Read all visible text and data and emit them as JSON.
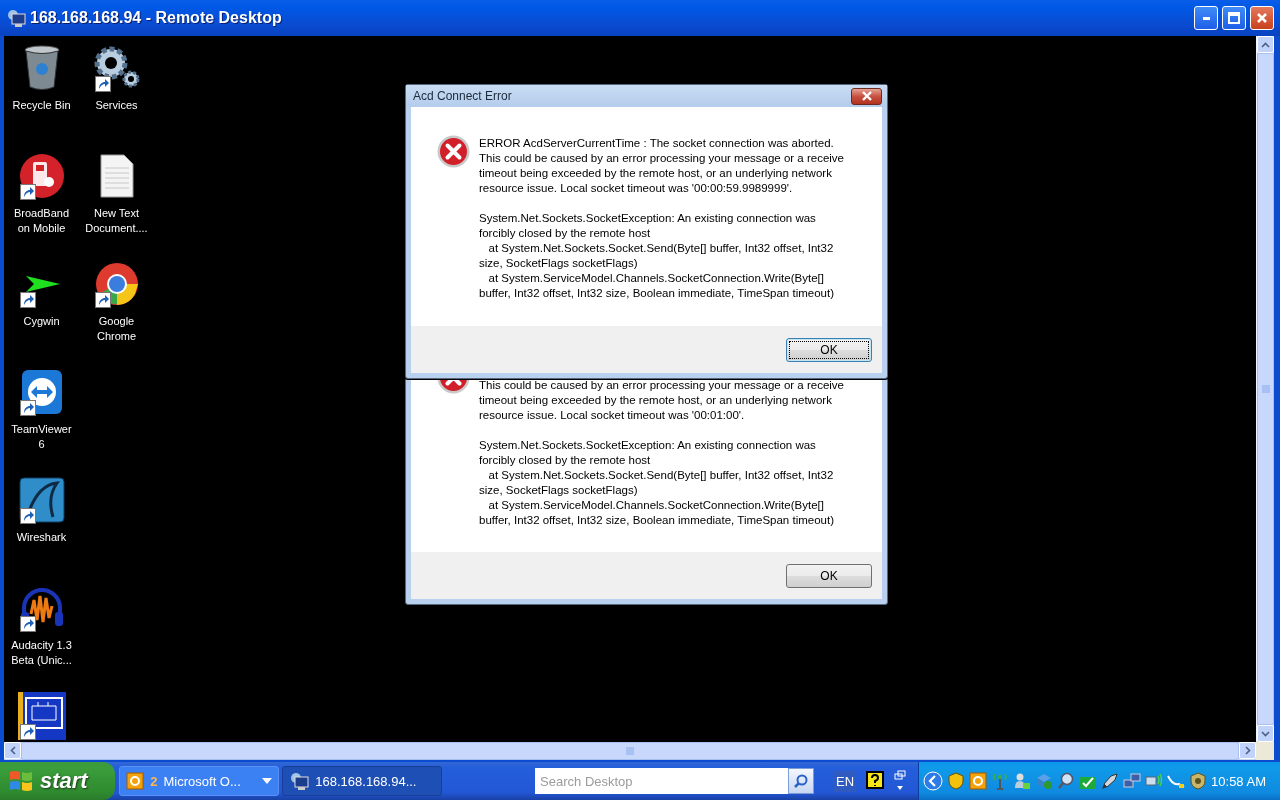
{
  "window": {
    "title": "168.168.168.94 - Remote Desktop"
  },
  "desktop_rows": [
    {
      "icons": [
        {
          "label": "Recycle Bin",
          "kind": "recycle-bin",
          "shortcut": false
        },
        {
          "label": "Services",
          "kind": "gears",
          "shortcut": true
        }
      ]
    },
    {
      "icons": [
        {
          "label": "BroadBand\non Mobile",
          "kind": "broadband",
          "shortcut": true
        },
        {
          "label": "New Text\nDocument....",
          "kind": "text-file",
          "shortcut": false
        }
      ]
    },
    {
      "icons": [
        {
          "label": "Cygwin",
          "kind": "cygwin",
          "shortcut": true
        },
        {
          "label": "Google\nChrome",
          "kind": "chrome",
          "shortcut": true
        }
      ]
    },
    {
      "icons": [
        {
          "label": "TeamViewer\n6",
          "kind": "teamviewer",
          "shortcut": true
        }
      ]
    },
    {
      "icons": [
        {
          "label": "Wireshark",
          "kind": "wireshark",
          "shortcut": true
        }
      ]
    },
    {
      "icons": [
        {
          "label": "Audacity 1.3\nBeta (Unic...",
          "kind": "audacity",
          "shortcut": true
        }
      ]
    },
    {
      "icons": [
        {
          "kind": "blueprint",
          "shortcut": true
        }
      ]
    }
  ],
  "dialogs": [
    {
      "title": "Acd Connect Error",
      "focused": true,
      "button": "OK",
      "paragraphs": [
        "ERROR AcdServerCurrentTime : The socket connection was aborted.\nThis could be caused by an error processing your message or a receive\ntimeout being exceeded by the remote host, or an underlying network\nresource issue. Local socket timeout was '00:00:59.9989999'.",
        "System.Net.Sockets.SocketException: An existing connection was\nforcibly closed by the remote host\n   at System.Net.Sockets.Socket.Send(Byte[] buffer, Int32 offset, Int32\nsize, SocketFlags socketFlags)\n   at System.ServiceModel.Channels.SocketConnection.Write(Byte[]\nbuffer, Int32 offset, Int32 size, Boolean immediate, TimeSpan timeout)"
      ]
    },
    {
      "focused": false,
      "button": "OK",
      "paragraphs": [
        "This could be caused by an error processing your message or a receive\ntimeout being exceeded by the remote host, or an underlying network\nresource issue. Local socket timeout was '00:01:00'.",
        "System.Net.Sockets.SocketException: An existing connection was\nforcibly closed by the remote host\n   at System.Net.Sockets.Socket.Send(Byte[] buffer, Int32 offset, Int32\nsize, SocketFlags socketFlags)\n   at System.ServiceModel.Channels.SocketConnection.Write(Byte[]\nbuffer, Int32 offset, Int32 size, Boolean immediate, TimeSpan timeout)"
      ]
    }
  ],
  "taskbar": {
    "start": "start",
    "tasks": [
      {
        "count": "2",
        "label": "Microsoft O...",
        "grouped": true,
        "selected": false
      },
      {
        "label": "168.168.168.94...",
        "grouped": false,
        "selected": true
      }
    ],
    "search": {
      "placeholder": "Search Desktop"
    },
    "language": "EN",
    "clock": "10:58 AM"
  }
}
